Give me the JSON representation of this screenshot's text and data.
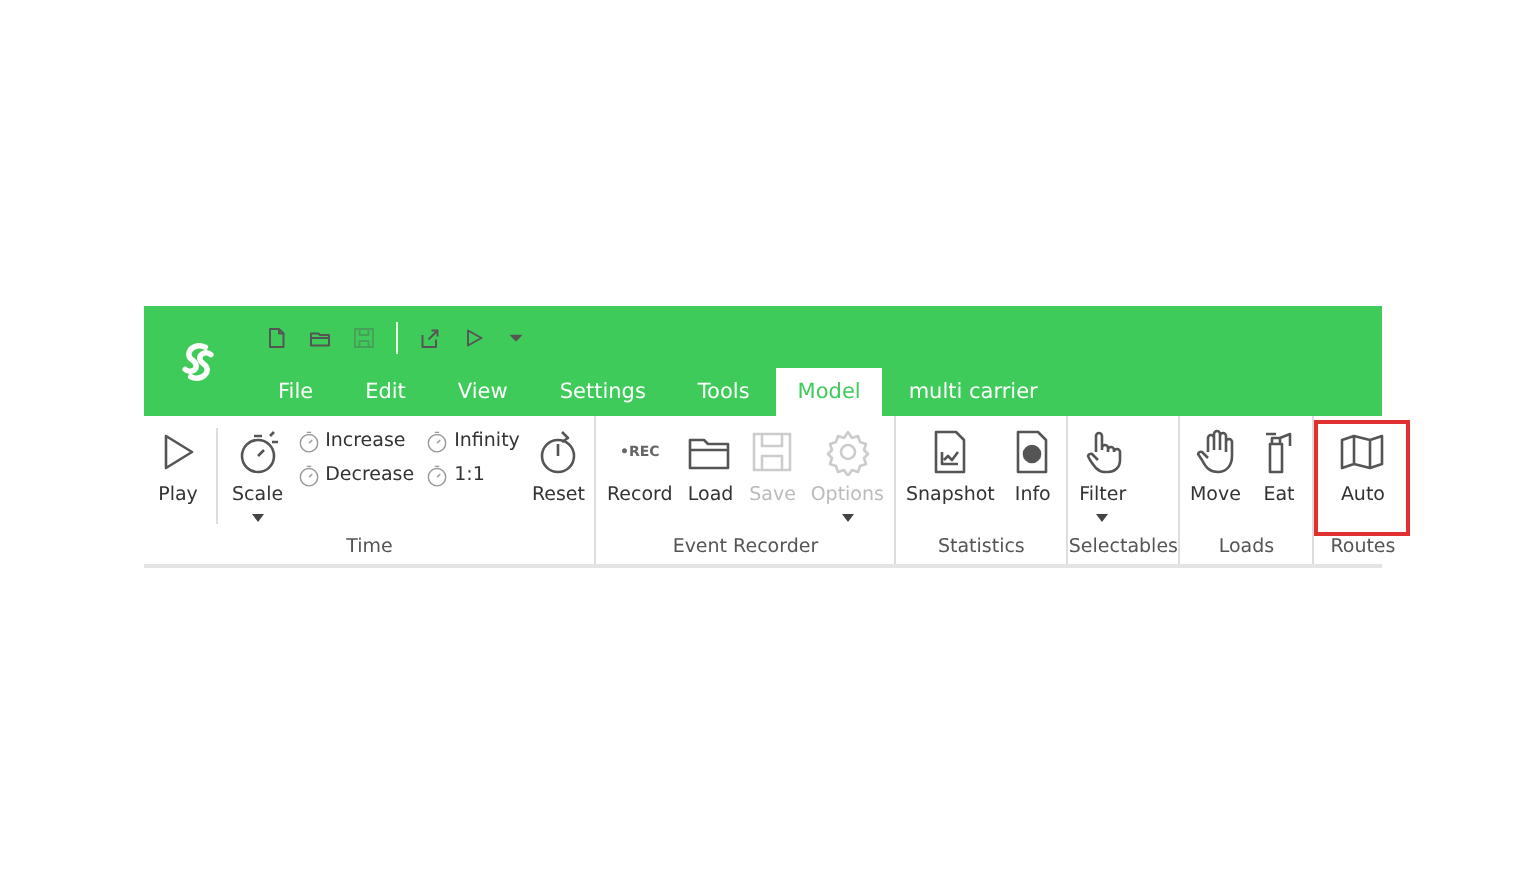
{
  "quick_access": [
    {
      "disabled": false
    },
    {
      "disabled": false
    },
    {
      "disabled": true
    },
    {
      "disabled": false
    },
    {
      "disabled": false
    },
    {
      "disabled": false
    }
  ],
  "tabs": [
    {
      "label": "File",
      "selected": false
    },
    {
      "label": "Edit",
      "selected": false
    },
    {
      "label": "View",
      "selected": false
    },
    {
      "label": "Settings",
      "selected": false
    },
    {
      "label": "Tools",
      "selected": false
    },
    {
      "label": "Model",
      "selected": true
    },
    {
      "label": "multi carrier",
      "selected": false
    }
  ],
  "groups": [
    {
      "label": "Time",
      "items": [
        {
          "kind": "large",
          "label": "Play",
          "disabled": false,
          "dropdown": false
        },
        {
          "kind": "separator"
        },
        {
          "kind": "large",
          "label": "Scale",
          "disabled": false,
          "dropdown": true
        },
        {
          "kind": "small",
          "label": "Increase",
          "disabled": false
        },
        {
          "kind": "small",
          "label": "Decrease",
          "disabled": false
        },
        {
          "kind": "small",
          "label": "Infinity",
          "disabled": false
        },
        {
          "kind": "small",
          "label": "1:1",
          "disabled": false
        },
        {
          "kind": "large",
          "label": "Reset",
          "disabled": false,
          "dropdown": false
        }
      ]
    },
    {
      "label": "Event Recorder",
      "items": [
        {
          "kind": "large",
          "label": "Record",
          "disabled": false,
          "dropdown": false,
          "badge": "•REC"
        },
        {
          "kind": "large",
          "label": "Load",
          "disabled": false,
          "dropdown": false
        },
        {
          "kind": "large",
          "label": "Save",
          "disabled": true,
          "dropdown": false
        },
        {
          "kind": "large",
          "label": "Options",
          "disabled": true,
          "dropdown": true
        }
      ]
    },
    {
      "label": "Statistics",
      "items": [
        {
          "kind": "large",
          "label": "Snapshot",
          "disabled": false,
          "dropdown": false
        },
        {
          "kind": "large",
          "label": "Info",
          "disabled": false,
          "dropdown": false
        }
      ]
    },
    {
      "label": "Selectables",
      "items": [
        {
          "kind": "large",
          "label": "Filter",
          "disabled": false,
          "dropdown": true
        }
      ]
    },
    {
      "label": "Loads",
      "items": [
        {
          "kind": "large",
          "label": "Move",
          "disabled": false,
          "dropdown": false
        },
        {
          "kind": "large",
          "label": "Eat",
          "disabled": false,
          "dropdown": false
        }
      ]
    },
    {
      "label": "Routes",
      "items": [
        {
          "kind": "large",
          "label": "Auto",
          "disabled": false,
          "dropdown": false,
          "highlighted": true
        }
      ]
    }
  ]
}
